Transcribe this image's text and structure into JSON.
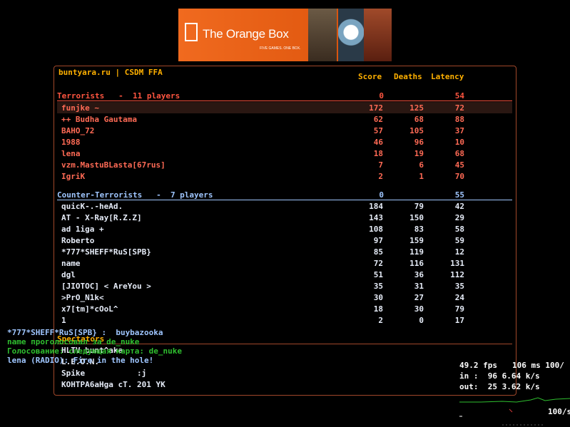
{
  "banner": {
    "title": "The Orange Box",
    "tagline": "FIVE GAMES. ONE BOX."
  },
  "scoreboard": {
    "server": "buntyara.ru | CSDM FFA",
    "columns": {
      "score": "Score",
      "deaths": "Deaths",
      "latency": "Latency"
    },
    "terrorists": {
      "label": "Terrorists   -  11 players",
      "score": "0",
      "latency": "54",
      "players": [
        {
          "name": "funjke ~",
          "score": "172",
          "deaths": "125",
          "latency": "72"
        },
        {
          "name": "++ Budha Gautama",
          "score": "62",
          "deaths": "68",
          "latency": "88"
        },
        {
          "name": "BAHO_72",
          "score": "57",
          "deaths": "105",
          "latency": "37"
        },
        {
          "name": "1988",
          "score": "46",
          "deaths": "96",
          "latency": "10"
        },
        {
          "name": "lena",
          "score": "18",
          "deaths": "19",
          "latency": "68"
        },
        {
          "name": "vzm.MastuBLasta[67rus]",
          "score": "7",
          "deaths": "6",
          "latency": "45"
        },
        {
          "name": "IgriK",
          "score": "2",
          "deaths": "1",
          "latency": "70"
        }
      ]
    },
    "counter_terrorists": {
      "label": "Counter-Terrorists   -  7 players",
      "score": "0",
      "latency": "55",
      "players": [
        {
          "name": "quicK-.-heAd.",
          "score": "184",
          "deaths": "79",
          "latency": "42"
        },
        {
          "name": "AT - X-Ray[R.Z.Z]",
          "score": "143",
          "deaths": "150",
          "latency": "29"
        },
        {
          "name": "ad 1iga +",
          "score": "108",
          "deaths": "83",
          "latency": "58"
        },
        {
          "name": "Roberto",
          "score": "97",
          "deaths": "159",
          "latency": "59"
        },
        {
          "name": "*777*SHEFF*RuS[SPB}",
          "score": "85",
          "deaths": "119",
          "latency": "12"
        },
        {
          "name": "name",
          "score": "72",
          "deaths": "116",
          "latency": "131"
        },
        {
          "name": "dgl",
          "score": "51",
          "deaths": "36",
          "latency": "112"
        },
        {
          "name": "[JIOTOC] < AreYou >",
          "score": "35",
          "deaths": "31",
          "latency": "35"
        },
        {
          "name": ">PrO_N1k<",
          "score": "30",
          "deaths": "27",
          "latency": "24"
        },
        {
          "name": "x7[tm]*cOoL^",
          "score": "18",
          "deaths": "30",
          "latency": "79"
        },
        {
          "name": "1",
          "score": "2",
          "deaths": "0",
          "latency": "17"
        }
      ]
    },
    "spectators": {
      "label": "Spectators",
      "players": [
        {
          "name": "HLTV bunt^aka"
        },
        {
          "name": "L.E.O.N."
        },
        {
          "name": "Spike           :j"
        },
        {
          "name": "KOHTPA6aHga cT. 201 YK"
        }
      ]
    }
  },
  "chat": [
    {
      "text": "*777*SHEFF*RuS[SPB} :  buybazooka"
    },
    {
      "text": "name проголосовал за de_nuke"
    },
    {
      "text": "Голосование: следующая карта: de_nuke"
    },
    {
      "text": "lena (RADIO): Fire in the hole!"
    }
  ],
  "netgraph": {
    "fps": "49.2 fps",
    "ms": "106 ms 100/",
    "in": "in :  96 6.64 k/s",
    "out": "out:  25 3.62 k/s",
    "rate": "100/s"
  },
  "colors": {
    "accent": "#ffb000",
    "terror": "#ff5540",
    "ct": "#9fc6ff",
    "border": "#a0472a"
  }
}
